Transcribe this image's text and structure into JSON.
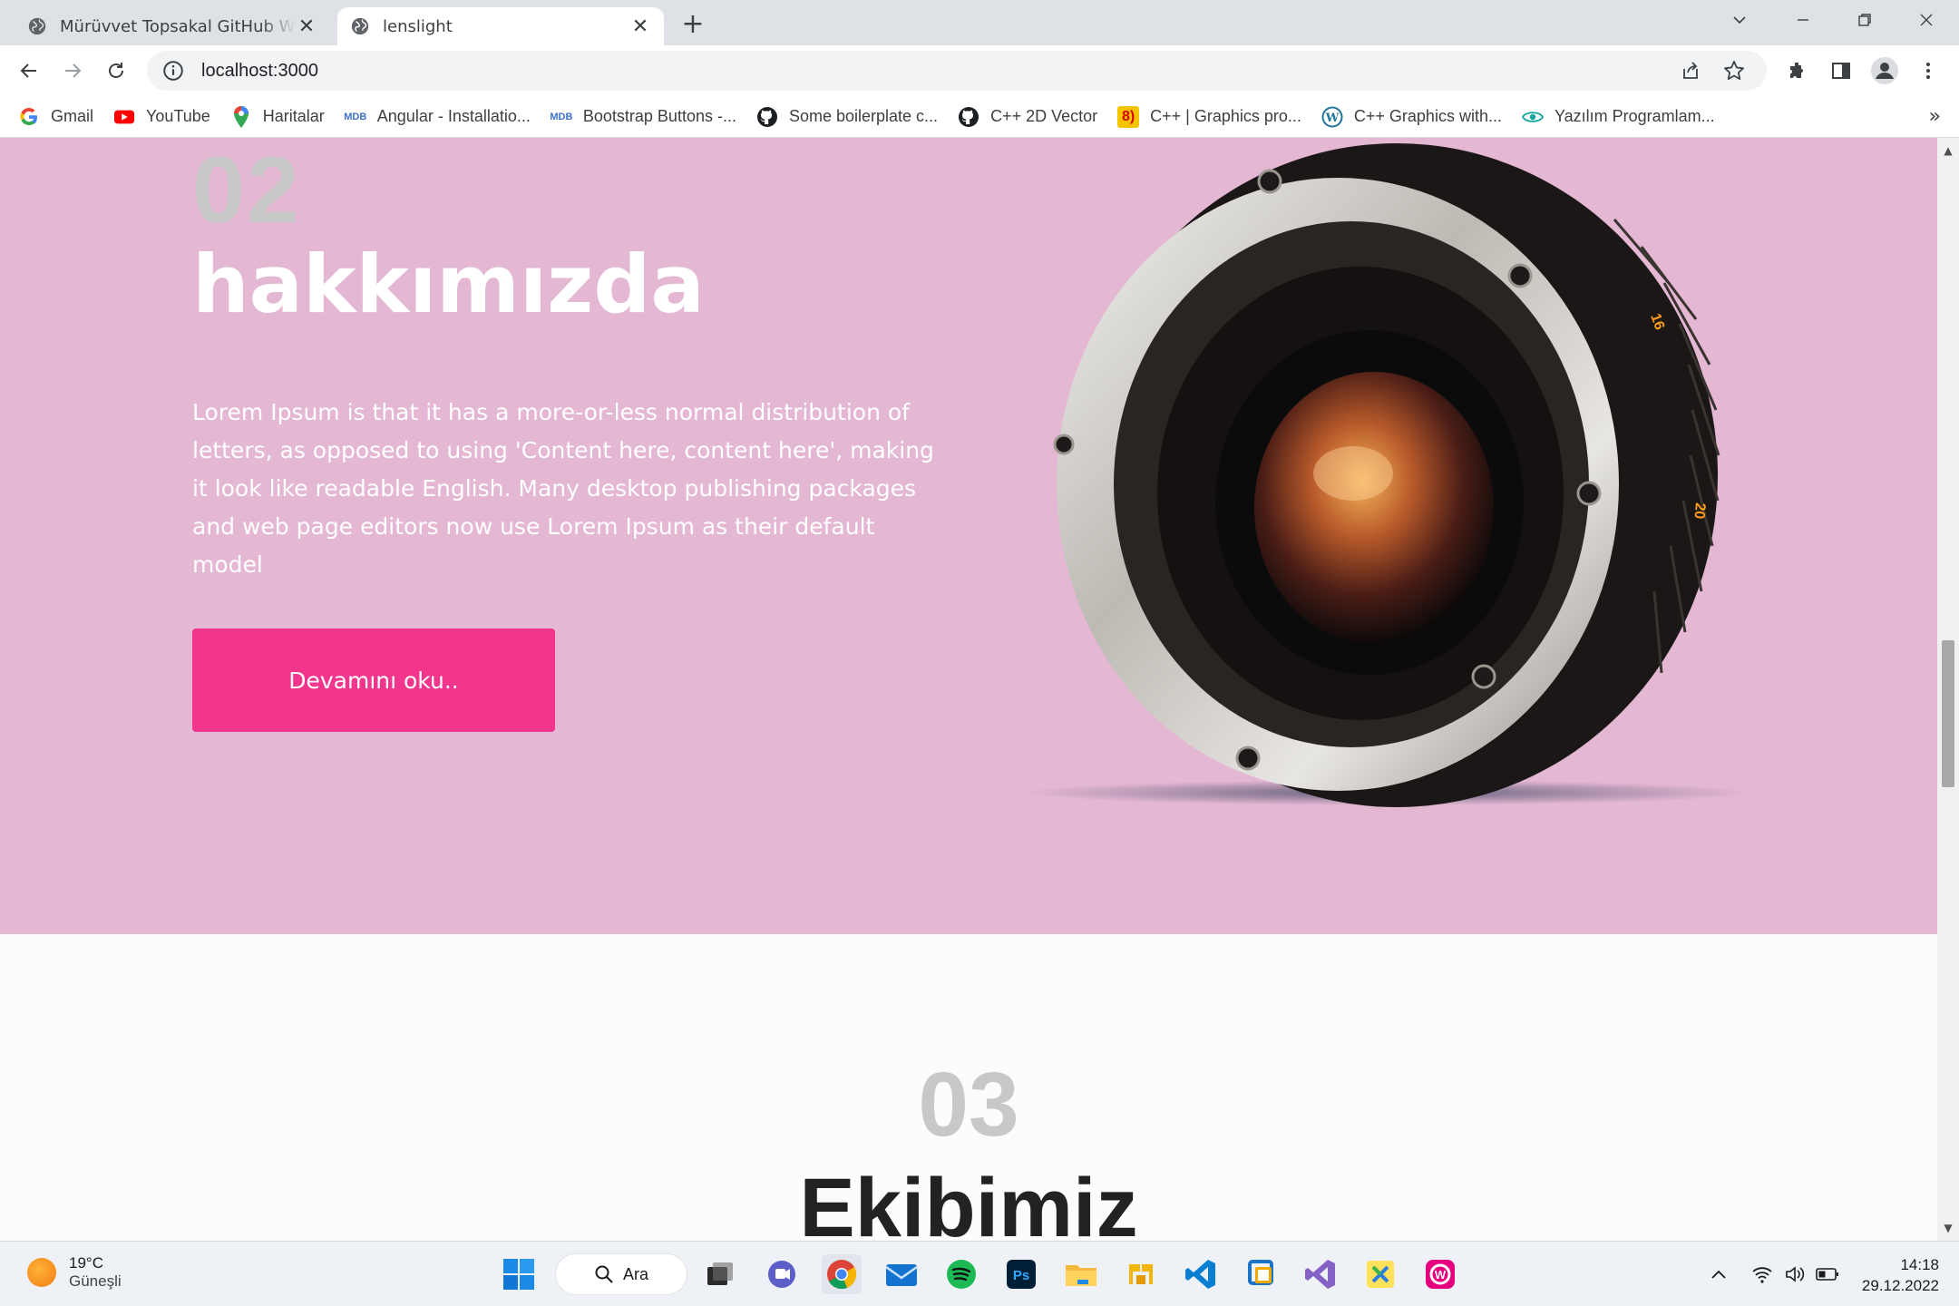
{
  "browser": {
    "tabs": [
      {
        "title": "Mürüvvet Topsakal GitHub Website",
        "active": false
      },
      {
        "title": "lenslight",
        "active": true
      }
    ],
    "url": "localhost:3000"
  },
  "bookmarks": [
    {
      "label": "Gmail",
      "icon": "google-icon"
    },
    {
      "label": "YouTube",
      "icon": "youtube-icon"
    },
    {
      "label": "Haritalar",
      "icon": "maps-pin-icon"
    },
    {
      "label": "Angular - Installatio...",
      "icon": "mdb-icon"
    },
    {
      "label": "Bootstrap Buttons -...",
      "icon": "mdb-icon"
    },
    {
      "label": "Some boilerplate c...",
      "icon": "github-icon"
    },
    {
      "label": "C++ 2D Vector",
      "icon": "github-icon"
    },
    {
      "label": "C++ | Graphics pro...",
      "icon": "geeks-icon"
    },
    {
      "label": "C++ Graphics with...",
      "icon": "wordpress-icon"
    },
    {
      "label": "Yazılım Programlam...",
      "icon": "eye-icon"
    }
  ],
  "about": {
    "number": "02",
    "heading": "hakkımızda",
    "body": "Lorem Ipsum is that it has a more-or-less normal distribution of letters, as opposed to using 'Content here, content here', making it look like readable English. Many desktop publishing packages and web page editors now use Lorem Ipsum as their default model",
    "button_label": "Devamını oku.."
  },
  "team": {
    "number": "03",
    "heading": "Ekibimiz"
  },
  "colors": {
    "about_bg": "#e4b7d3",
    "accent_button": "#f4358d",
    "section_number": "#c8c8c8"
  },
  "taskbar": {
    "weather_temp": "19°C",
    "weather_desc": "Güneşli",
    "search_label": "Ara",
    "time": "14:18",
    "date": "29.12.2022"
  }
}
